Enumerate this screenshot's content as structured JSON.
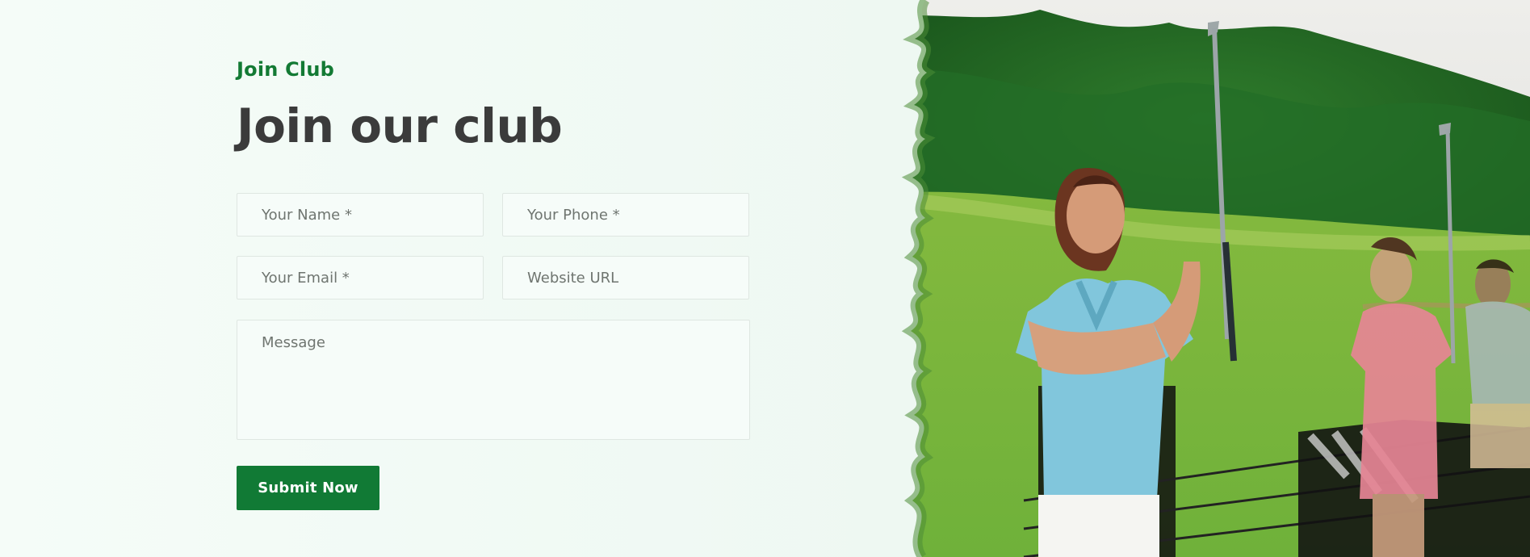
{
  "section": {
    "eyebrow": "Join Club",
    "title": "Join our club"
  },
  "form": {
    "name_placeholder": "Your Name *",
    "phone_placeholder": "Your Phone *",
    "email_placeholder": "Your Email *",
    "website_placeholder": "Website URL",
    "message_placeholder": "Message",
    "submit_label": "Submit Now"
  },
  "colors": {
    "accent": "#117a35",
    "heading": "#3b3b3b",
    "background": "#eef8f3"
  },
  "image": {
    "icon_name": "golf-players-photo"
  }
}
